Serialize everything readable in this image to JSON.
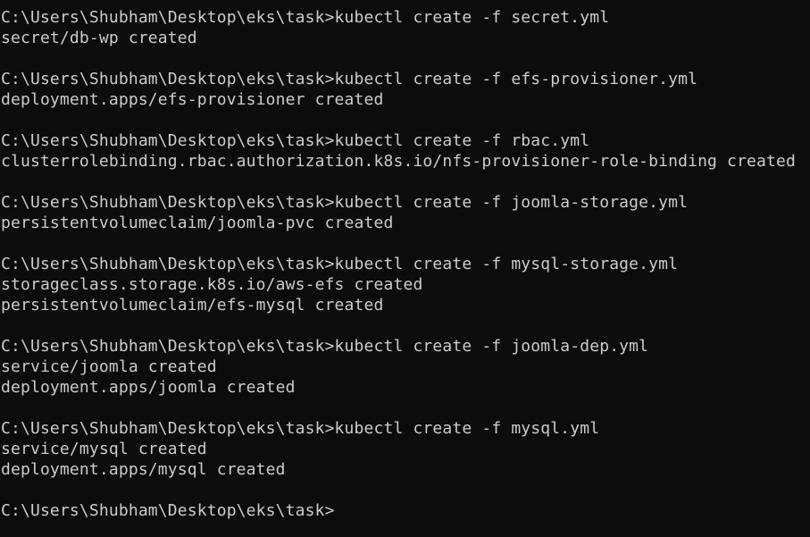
{
  "terminal": {
    "lines": [
      "C:\\Users\\Shubham\\Desktop\\eks\\task>kubectl create -f secret.yml",
      "secret/db-wp created",
      "",
      "C:\\Users\\Shubham\\Desktop\\eks\\task>kubectl create -f efs-provisioner.yml",
      "deployment.apps/efs-provisioner created",
      "",
      "C:\\Users\\Shubham\\Desktop\\eks\\task>kubectl create -f rbac.yml",
      "clusterrolebinding.rbac.authorization.k8s.io/nfs-provisioner-role-binding created",
      "",
      "C:\\Users\\Shubham\\Desktop\\eks\\task>kubectl create -f joomla-storage.yml",
      "persistentvolumeclaim/joomla-pvc created",
      "",
      "C:\\Users\\Shubham\\Desktop\\eks\\task>kubectl create -f mysql-storage.yml",
      "storageclass.storage.k8s.io/aws-efs created",
      "persistentvolumeclaim/efs-mysql created",
      "",
      "C:\\Users\\Shubham\\Desktop\\eks\\task>kubectl create -f joomla-dep.yml",
      "service/joomla created",
      "deployment.apps/joomla created",
      "",
      "C:\\Users\\Shubham\\Desktop\\eks\\task>kubectl create -f mysql.yml",
      "service/mysql created",
      "deployment.apps/mysql created",
      "",
      "C:\\Users\\Shubham\\Desktop\\eks\\task>"
    ],
    "colors": {
      "background": "#0c0c0c",
      "text": "#cccccc"
    }
  }
}
